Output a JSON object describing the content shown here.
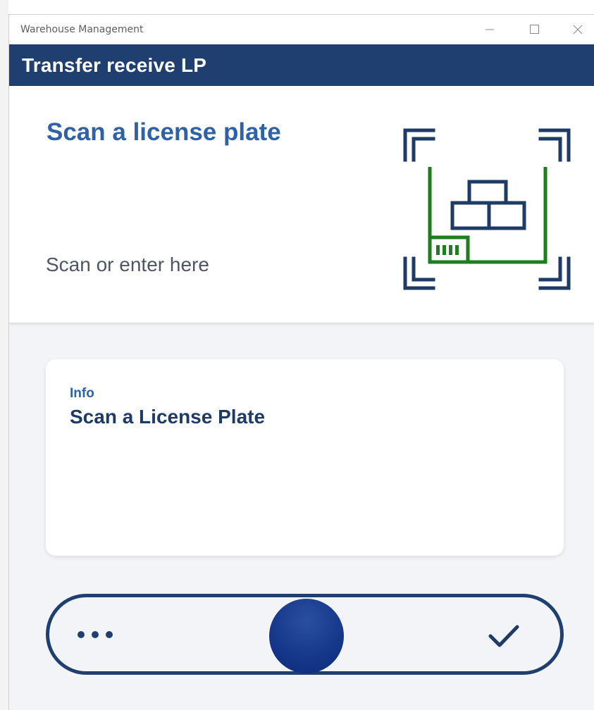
{
  "window": {
    "title": "Warehouse Management",
    "minimize_icon": "minimize-icon",
    "maximize_icon": "maximize-icon",
    "close_icon": "close-icon"
  },
  "header": {
    "title": "Transfer receive LP",
    "background": "#1e3f6f"
  },
  "scan": {
    "title": "Scan a license plate",
    "placeholder": "Scan or enter here",
    "value": "",
    "icon": "license-plate-scan-icon",
    "accent": "#2d62a8",
    "icon_green": "#1e7d1e"
  },
  "info": {
    "label": "Info",
    "value": "Scan a License Plate"
  },
  "action_bar": {
    "more_icon": "more-dots-icon",
    "center_button": "primary-action-button",
    "confirm_icon": "checkmark-icon"
  }
}
